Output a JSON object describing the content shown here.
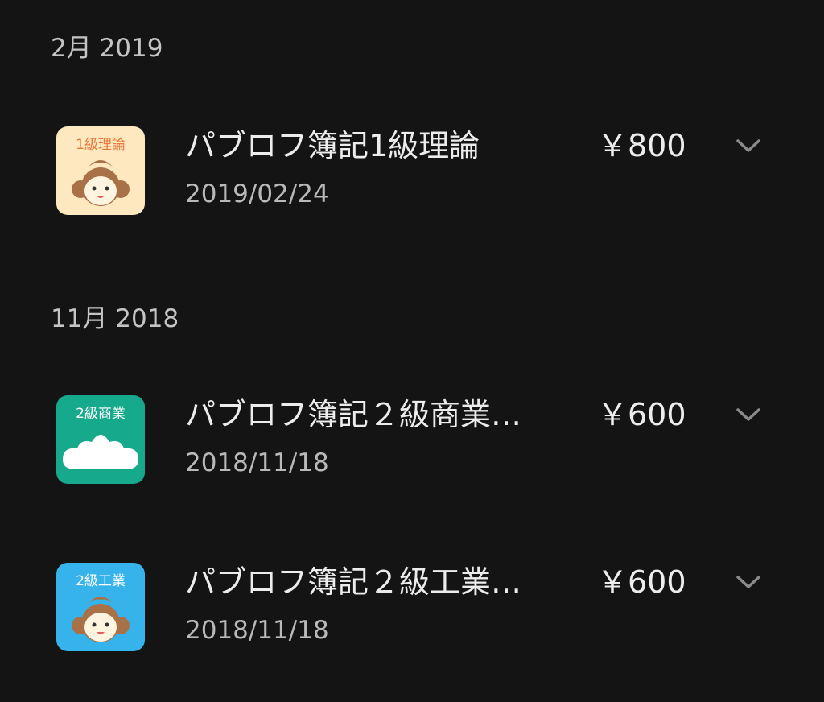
{
  "sections": [
    {
      "header": "2月 2019",
      "items": [
        {
          "icon_name": "pavlov-1kyu-riron-app-icon",
          "icon_text": "1級理論",
          "icon_bg": "#fde8c0",
          "title": "パブロフ簿記1級理論",
          "date": "2019/02/24",
          "price": "￥800"
        }
      ]
    },
    {
      "header": "11月 2018",
      "items": [
        {
          "icon_name": "pavlov-2kyu-shogyo-app-icon",
          "icon_text": "2級商業",
          "icon_bg": "#17a98b",
          "title": "パブロフ簿記２級商業…",
          "date": "2018/11/18",
          "price": "￥600"
        },
        {
          "icon_name": "pavlov-2kyu-kogyo-app-icon",
          "icon_text": "2級工業",
          "icon_bg": "#36b3ea",
          "title": "パブロフ簿記２級工業…",
          "date": "2018/11/18",
          "price": "￥600"
        }
      ]
    }
  ],
  "colors": {
    "background": "#141414",
    "header_text": "#c4c4c4",
    "title_text": "#ececec",
    "date_text": "#b9b9b9",
    "chevron": "#8a8a8a"
  }
}
